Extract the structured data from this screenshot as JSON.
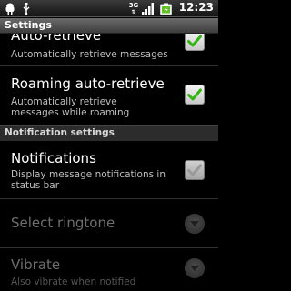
{
  "status_bar": {
    "network": "3G",
    "time": "12:23",
    "icons": [
      "android-icon",
      "usb-icon",
      "signal-icon",
      "battery-icon"
    ]
  },
  "title_bar": {
    "title": "Settings"
  },
  "preferences": {
    "auto_retrieve": {
      "title": "Auto-retrieve",
      "summary": "Automatically retrieve messages",
      "checked": true
    },
    "roaming_auto_retrieve": {
      "title": "Roaming auto-retrieve",
      "summary": "Automatically retrieve messages while roaming",
      "checked": true
    },
    "notification_section": {
      "label": "Notification settings"
    },
    "notifications": {
      "title": "Notifications",
      "summary": "Display message notifications in status bar",
      "checked": true
    },
    "select_ringtone": {
      "title": "Select ringtone",
      "enabled": false
    },
    "vibrate": {
      "title": "Vibrate",
      "summary": "Also vibrate when notified",
      "enabled": false
    }
  },
  "colors": {
    "check_green": "#34b414",
    "background": "#000000",
    "summary_text": "#bfbfbf",
    "disabled_text": "#6e6e6e"
  }
}
